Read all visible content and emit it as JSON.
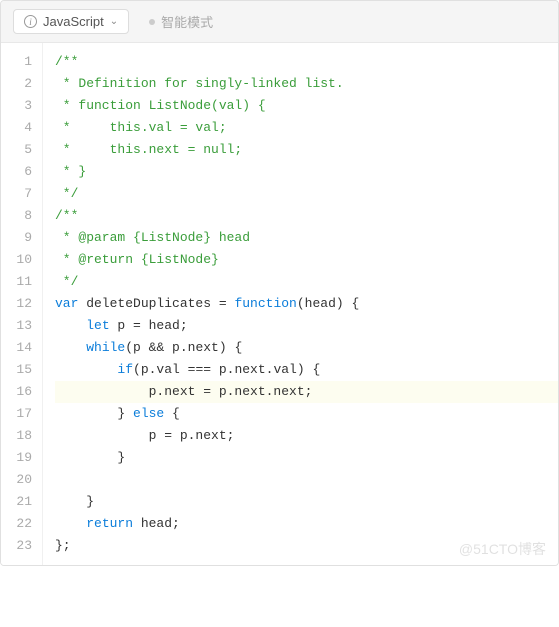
{
  "header": {
    "language": "JavaScript",
    "mode": "智能模式"
  },
  "code": {
    "lines": [
      {
        "n": 1,
        "cls": "c-comment",
        "t": "/**"
      },
      {
        "n": 2,
        "cls": "c-comment",
        "t": " * Definition for singly-linked list."
      },
      {
        "n": 3,
        "cls": "c-comment",
        "t": " * function ListNode(val) {"
      },
      {
        "n": 4,
        "cls": "c-comment",
        "t": " *     this.val = val;"
      },
      {
        "n": 5,
        "cls": "c-comment",
        "t": " *     this.next = null;"
      },
      {
        "n": 6,
        "cls": "c-comment",
        "t": " * }"
      },
      {
        "n": 7,
        "cls": "c-comment",
        "t": " */"
      },
      {
        "n": 8,
        "cls": "c-comment",
        "t": "/**"
      },
      {
        "n": 9,
        "cls": "c-comment",
        "t": " * @param {ListNode} head"
      },
      {
        "n": 10,
        "cls": "c-comment",
        "t": " * @return {ListNode}"
      },
      {
        "n": 11,
        "cls": "c-comment",
        "t": " */"
      },
      {
        "n": 12,
        "html": "<span class='c-kw'>var</span> deleteDuplicates = <span class='c-kw'>function</span>(head) {"
      },
      {
        "n": 13,
        "html": "    <span class='c-kw'>let</span> p = head;"
      },
      {
        "n": 14,
        "html": "    <span class='c-kw'>while</span>(p &amp;&amp; p.next) {"
      },
      {
        "n": 15,
        "html": "        <span class='c-kw'>if</span>(p.val === p.next.val) {"
      },
      {
        "n": 16,
        "hl": true,
        "html": "            p.next = p.next.next;"
      },
      {
        "n": 17,
        "html": "        } <span class='c-kw'>else</span> {"
      },
      {
        "n": 18,
        "html": "            p = p.next;"
      },
      {
        "n": 19,
        "html": "        }"
      },
      {
        "n": 20,
        "html": ""
      },
      {
        "n": 21,
        "html": "    }"
      },
      {
        "n": 22,
        "html": "    <span class='c-kw'>return</span> head;"
      },
      {
        "n": 23,
        "html": "};"
      }
    ]
  },
  "watermark": "@51CTO博客"
}
